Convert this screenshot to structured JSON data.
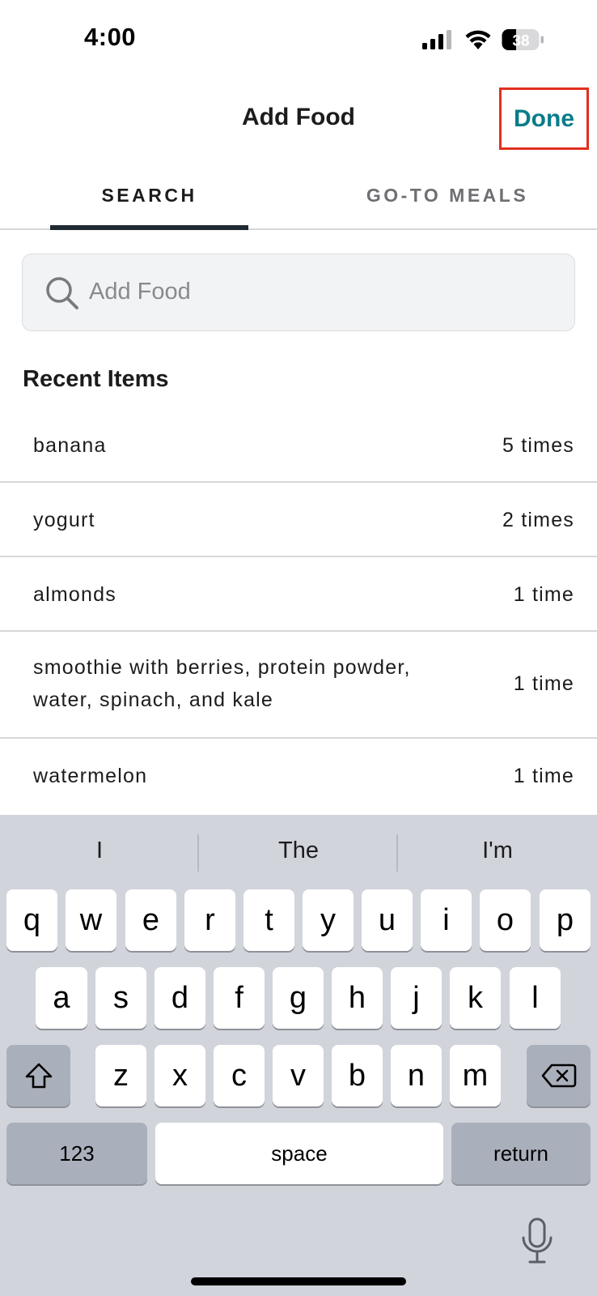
{
  "status_bar": {
    "time": "4:00",
    "battery_level": "38",
    "icons": [
      "signal-icon",
      "wifi-icon",
      "battery-icon"
    ]
  },
  "header": {
    "title": "Add Food",
    "done_label": "Done",
    "done_color": "#0a7c89",
    "highlight_color": "#e0301e"
  },
  "tabs": [
    {
      "label": "SEARCH",
      "active": true
    },
    {
      "label": "GO-TO MEALS",
      "active": false
    }
  ],
  "search": {
    "placeholder": "Add Food",
    "value": "",
    "icon": "search-icon"
  },
  "recent": {
    "title": "Recent Items",
    "items": [
      {
        "name": "banana",
        "count": "5 times"
      },
      {
        "name": "yogurt",
        "count": "2 times"
      },
      {
        "name": "almonds",
        "count": "1 time"
      },
      {
        "name": "smoothie with berries, protein powder, water, spinach, and kale",
        "count": "1 time"
      },
      {
        "name": "watermelon",
        "count": "1 time"
      }
    ]
  },
  "keyboard": {
    "suggestions": [
      "I",
      "The",
      "I'm"
    ],
    "row1": [
      "q",
      "w",
      "e",
      "r",
      "t",
      "y",
      "u",
      "i",
      "o",
      "p"
    ],
    "row2": [
      "a",
      "s",
      "d",
      "f",
      "g",
      "h",
      "j",
      "k",
      "l"
    ],
    "row3": [
      "z",
      "x",
      "c",
      "v",
      "b",
      "n",
      "m"
    ],
    "numbers_label": "123",
    "space_label": "space",
    "return_label": "return",
    "icons": [
      "shift-icon",
      "delete-icon",
      "microphone-icon"
    ]
  }
}
